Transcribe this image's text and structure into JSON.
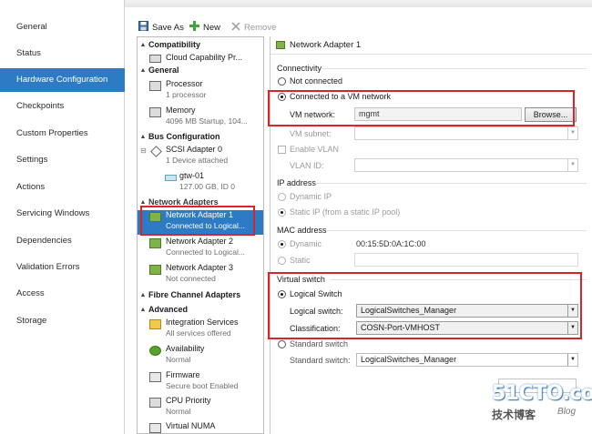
{
  "nav": {
    "items": [
      {
        "label": "General"
      },
      {
        "label": "Status"
      },
      {
        "label": "Hardware Configuration",
        "active": true
      },
      {
        "label": "Checkpoints"
      },
      {
        "label": "Custom Properties"
      },
      {
        "label": "Settings"
      },
      {
        "label": "Actions"
      },
      {
        "label": "Servicing Windows"
      },
      {
        "label": "Dependencies"
      },
      {
        "label": "Validation Errors"
      },
      {
        "label": "Access"
      },
      {
        "label": "Storage"
      }
    ]
  },
  "toolbar": {
    "save_as": "Save As",
    "new": "New",
    "remove": "Remove"
  },
  "tree": {
    "sections": {
      "compatibility": "Compatibility",
      "general": "General",
      "bus": "Bus Configuration",
      "network": "Network Adapters",
      "fibre": "Fibre Channel Adapters",
      "advanced": "Advanced"
    },
    "items": {
      "cloud": {
        "title": "Cloud Capability Pr..."
      },
      "processor": {
        "title": "Processor",
        "sub": "1 processor"
      },
      "memory": {
        "title": "Memory",
        "sub": "4096 MB Startup, 104..."
      },
      "scsi": {
        "title": "SCSI Adapter 0",
        "sub": "1 Device attached"
      },
      "disk": {
        "title": "gtw-01",
        "sub": "127.00 GB, ID 0"
      },
      "na1": {
        "title": "Network Adapter 1",
        "sub": "Connected to Logical..."
      },
      "na2": {
        "title": "Network Adapter 2",
        "sub": "Connected to Logical..."
      },
      "na3": {
        "title": "Network Adapter 3",
        "sub": "Not connected"
      },
      "integration": {
        "title": "Integration Services",
        "sub": "All services offered"
      },
      "availability": {
        "title": "Availability",
        "sub": "Normal"
      },
      "firmware": {
        "title": "Firmware",
        "sub": "Secure boot Enabled"
      },
      "cpu": {
        "title": "CPU Priority",
        "sub": "Normal"
      },
      "numa": {
        "title": "Virtual NUMA"
      }
    }
  },
  "props": {
    "header": "Network Adapter 1",
    "connectivity": {
      "heading": "Connectivity",
      "not_connected": "Not connected",
      "connected_vm": "Connected to a VM network",
      "vm_network_label": "VM network:",
      "vm_network_value": "mgmt",
      "browse": "Browse...",
      "vm_subnet_label": "VM subnet:",
      "enable_vlan": "Enable VLAN",
      "vlan_id_label": "VLAN ID:"
    },
    "ip": {
      "heading": "IP address",
      "dynamic": "Dynamic IP",
      "static": "Static IP (from a static IP pool)"
    },
    "mac": {
      "heading": "MAC address",
      "dynamic": "Dynamic",
      "dynamic_value": "00:15:5D:0A:1C:00",
      "static": "Static"
    },
    "vswitch": {
      "heading": "Virtual switch",
      "logical_switch": "Logical Switch",
      "logical_switch_label": "Logical switch:",
      "logical_switch_value": "LogicalSwitches_Manager",
      "classification_label": "Classification:",
      "classification_value": "COSN-Port-VMHOST",
      "standard_switch": "Standard switch",
      "standard_switch_label": "Standard switch:",
      "standard_switch_value": "LogicalSwitches_Manager"
    }
  },
  "watermark": {
    "brand": "51CTO.com",
    "sub": "技术博客",
    "blog": "Blog"
  },
  "colors": {
    "accent": "#2d7bc4",
    "highlight_box": "#d7262b"
  }
}
